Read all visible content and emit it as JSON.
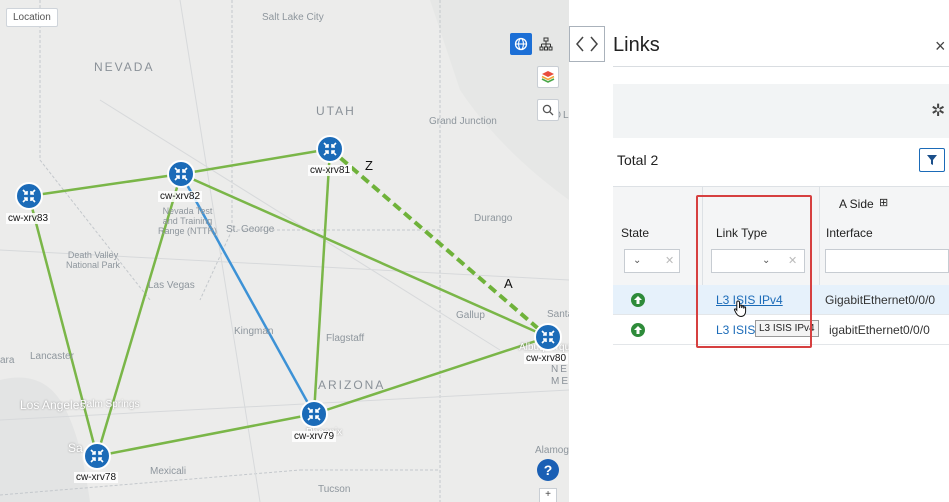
{
  "map": {
    "location_label": "Location",
    "labels": {
      "salt_lake_city": "Salt Lake City",
      "nevada": "NEVADA",
      "utah": "UTAH",
      "grand_junction": "Grand Junction",
      "col": "COL",
      "st_george": "St. George",
      "nevada_test": "Nevada Test\nand Training\nRange (NTTR)",
      "death_valley": "Death Valley\nNational Park",
      "las_vegas": "Las Vegas",
      "durango": "Durango",
      "gallup": "Gallup",
      "santa": "Santa",
      "kingman": "Kingman",
      "flagstaff": "Flagstaff",
      "lancaster": "Lancaster",
      "lara": "ara",
      "arizona": "ARIZONA",
      "nev_mex": "NEV\nMEX",
      "los_angeles": "Los Angeles",
      "palm_springs": "Palm Springs",
      "sa_ego": "Sa   go",
      "mexicali": "Mexicali",
      "phoenix": "Phoenix",
      "alamog": "Alamog",
      "tucson": "Tucson",
      "albuquerque": "Albuquerque"
    },
    "nodes": [
      {
        "id": "cw-xrv81"
      },
      {
        "id": "cw-xrv82"
      },
      {
        "id": "cw-xrv83"
      },
      {
        "id": "cw-xrv80"
      },
      {
        "id": "cw-xrv79"
      },
      {
        "id": "cw-xrv78"
      }
    ],
    "edge_labels": {
      "z": "Z",
      "a": "A"
    },
    "controls": [
      "globe-icon",
      "topology-icon",
      "layers-icon",
      "search-icon"
    ],
    "help": "?",
    "zoom_stub": "+",
    "colors": {
      "link_green": "#7ab648",
      "link_blue": "#3d92d6",
      "node": "#1b6bb8",
      "dashed": "#6fb23a"
    }
  },
  "panel": {
    "title": "Links",
    "close": "×",
    "total": "Total 2",
    "columns": {
      "state": "State",
      "link_type": "Link Type",
      "a_side": "A Side",
      "a_side_expand": "⊞",
      "interface": "Interface"
    },
    "rows": [
      {
        "state": "up",
        "link_type": "L3 ISIS IPv4",
        "interface": "GigabitEthernet0/0/0"
      },
      {
        "state": "up",
        "link_type": "L3 ISIS",
        "interface": "GigabitEthernet0/0/0"
      }
    ],
    "tooltip": "L3 ISIS IPv4",
    "row2_interface_visible": "igabitEthernet0/0/0"
  }
}
